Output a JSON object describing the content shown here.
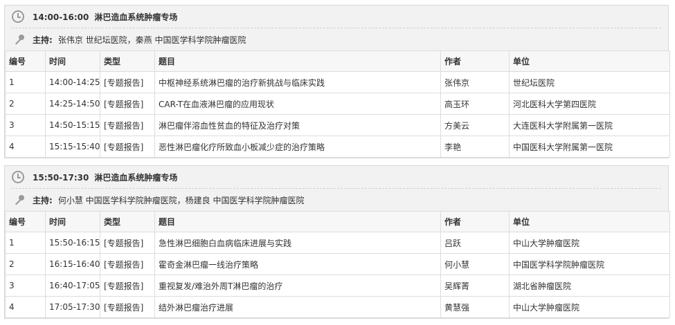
{
  "columns": [
    "编号",
    "时间",
    "类型",
    "题目",
    "作者",
    "单位"
  ],
  "sessions": [
    {
      "time": "14:00-16:00",
      "title": "淋巴造血系统肿瘤专场",
      "host_label": "主持:",
      "hosts": "张伟京 世纪坛医院，秦燕 中国医学科学院肿瘤医院",
      "rows": [
        {
          "no": "1",
          "time": "14:00-14:25",
          "type": "[专题报告]",
          "topic": "中枢神经系统淋巴瘤的治疗新挑战与临床实践",
          "author": "张伟京",
          "org": "世纪坛医院"
        },
        {
          "no": "2",
          "time": "14:25-14:50",
          "type": "[专题报告]",
          "topic": "CAR-T在血液淋巴瘤的应用现状",
          "author": "高玉环",
          "org": "河北医科大学第四医院"
        },
        {
          "no": "3",
          "time": "14:50-15:15",
          "type": "[专题报告]",
          "topic": "淋巴瘤伴溶血性贫血的特征及治疗对策",
          "author": "方美云",
          "org": "大连医科大学附属第一医院"
        },
        {
          "no": "4",
          "time": "15:15-15:40",
          "type": "[专题报告]",
          "topic": "恶性淋巴瘤化疗所致血小板减少症的治疗策略",
          "author": "李艳",
          "org": "中国医科大学附属第一医院"
        }
      ]
    },
    {
      "time": "15:50-17:30",
      "title": "淋巴造血系统肿瘤专场",
      "host_label": "主持:",
      "hosts": "何小慧 中国医学科学院肿瘤医院，杨建良 中国医学科学院肿瘤医院",
      "rows": [
        {
          "no": "1",
          "time": "15:50-16:15",
          "type": "[专题报告]",
          "topic": "急性淋巴细胞白血病临床进展与实践",
          "author": "吕跃",
          "org": "中山大学肿瘤医院"
        },
        {
          "no": "2",
          "time": "16:15-16:40",
          "type": "[专题报告]",
          "topic": "霍奇金淋巴瘤一线治疗策略",
          "author": "何小慧",
          "org": "中国医学科学院肿瘤医院"
        },
        {
          "no": "3",
          "time": "16:40-17:05",
          "type": "[专题报告]",
          "topic": "重视复发/难治外周T淋巴瘤的治疗",
          "author": "吴辉菁",
          "org": "湖北省肿瘤医院"
        },
        {
          "no": "4",
          "time": "17:05-17:30",
          "type": "[专题报告]",
          "topic": "结外淋巴瘤治疗进展",
          "author": "黄慧强",
          "org": "中山大学肿瘤医院"
        }
      ]
    }
  ]
}
